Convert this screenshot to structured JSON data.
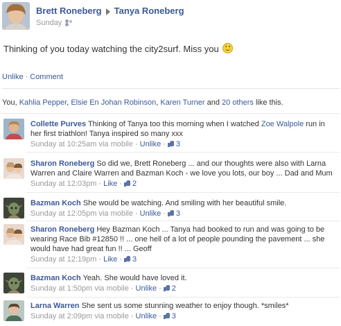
{
  "post": {
    "author": "Brett Roneberg",
    "target": "Tanya Roneberg",
    "time": "Sunday",
    "text": "Thinking of you today watching the city2surf. Miss you",
    "actions": {
      "unlike": "Unlike",
      "comment": "Comment"
    }
  },
  "likes": {
    "prefix": "You, ",
    "people": [
      "Kahlia Pepper",
      "Elsie En Johan Robinson",
      "Karen Turner"
    ],
    "sep1": ", ",
    "sep2": ", ",
    "and": " and ",
    "others": "20 others",
    "suffix": " like this."
  },
  "comments": [
    {
      "author": "Collette Purves",
      "text_before": "Thinking of Tanya too this morning when I watched ",
      "mention": "Zoe Walpole",
      "text_after": " run in her first triathlon! Tanya inspired so many xxx",
      "time": "Sunday at 10:25am via mobile",
      "action": "Unlike",
      "likes": "3",
      "avatar_color": "#c7a06b"
    },
    {
      "author": "Sharon Roneberg",
      "text": "So did we, Brett Roneberg ... and our thoughts were also with Larna Warren and Claire Warren and Bazman Koch - we love you lots, our boy ... Dad and Mum",
      "time": "Sunday at 12:03pm",
      "action": "Like",
      "likes": "2",
      "avatar_color": "#d8b7a6"
    },
    {
      "author": "Bazman Koch",
      "text": "She would be watching. And smiling with her beautiful smile.",
      "time": "Sunday at 12:05pm via mobile",
      "action": "Unlike",
      "likes": "3",
      "avatar_color": "#6f7a5a"
    },
    {
      "author": "Sharon Roneberg",
      "text": "Hey Bazman Koch ... Tanya had booked to run and was going to be wearing Race Bib #12850 !! ... one hell of a lot of people pounding the pavement ... she would have had great fun !! ... Geoff",
      "time": "Sunday at 12:19pm",
      "action": "Like",
      "likes": "3",
      "avatar_color": "#d8b7a6"
    },
    {
      "author": "Bazman Koch",
      "text": "Yeah. She would have loved it.",
      "time": "Sunday at 1:50pm via mobile",
      "action": "Unlike",
      "likes": "2",
      "avatar_color": "#6f7a5a"
    },
    {
      "author": "Larna Warren",
      "text": "She sent us some stunning weather to enjoy though. *smiles*",
      "time": "Sunday at 2:09pm via mobile",
      "action": "Unlike",
      "likes": "3",
      "avatar_color": "#8fa08b"
    }
  ]
}
